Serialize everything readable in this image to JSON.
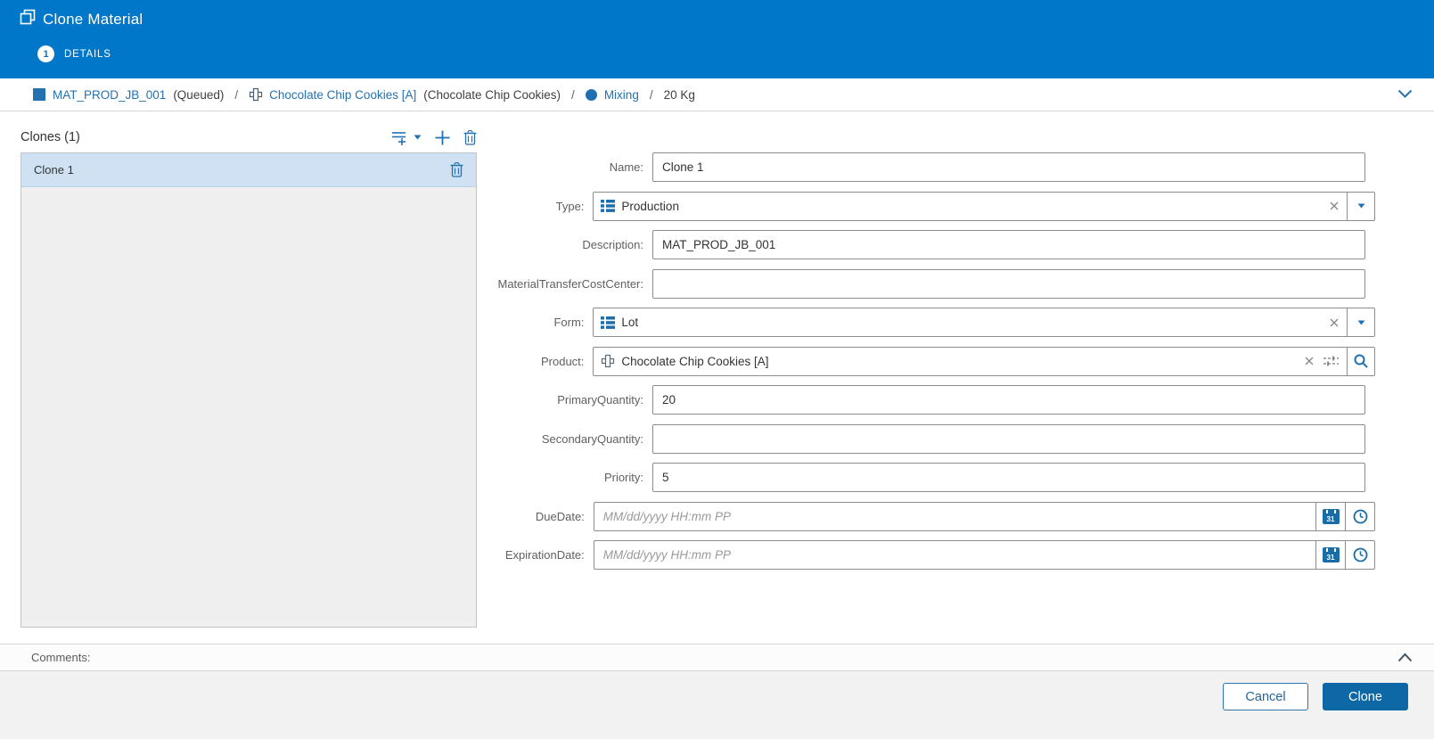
{
  "window": {
    "title": "Clone Material"
  },
  "steps": {
    "current_number": "1",
    "current_label": "DETAILS"
  },
  "breadcrumb": {
    "sep": "/",
    "material_name": "MAT_PROD_JB_001",
    "material_status": "(Queued)",
    "product_name": "Chocolate Chip Cookies [A]",
    "product_description": "(Chocolate Chip Cookies)",
    "step_name": "Mixing",
    "quantity": "20 Kg"
  },
  "clones": {
    "title": "Clones (1)",
    "items": [
      {
        "name": "Clone 1",
        "selected": true
      }
    ]
  },
  "form": {
    "rows": [
      {
        "label": "Name:",
        "value": "Clone 1"
      },
      {
        "label": "Type:",
        "value": "Production"
      },
      {
        "label": "Description:",
        "value": "MAT_PROD_JB_001"
      },
      {
        "label": "MaterialTransferCostCenter:",
        "value": ""
      },
      {
        "label": "Form:",
        "value": "Lot"
      },
      {
        "label": "Product:",
        "value": "Chocolate Chip Cookies [A]"
      },
      {
        "label": "PrimaryQuantity:",
        "value": "20"
      },
      {
        "label": "SecondaryQuantity:",
        "value": ""
      },
      {
        "label": "Priority:",
        "value": "5"
      },
      {
        "label": "DueDate:",
        "placeholder": "MM/dd/yyyy HH:mm PP"
      },
      {
        "label": "ExpirationDate:",
        "placeholder": "MM/dd/yyyy HH:mm PP"
      }
    ]
  },
  "icons": {
    "calendar_day": "31"
  },
  "comments": {
    "label": "Comments:"
  },
  "footer": {
    "cancel_label": "Cancel",
    "clone_label": "Clone"
  },
  "colors": {
    "header": "#0077c8",
    "accent": "#2272b2",
    "primary_button": "#0d68a5",
    "selected_row": "#cfe1f2"
  }
}
